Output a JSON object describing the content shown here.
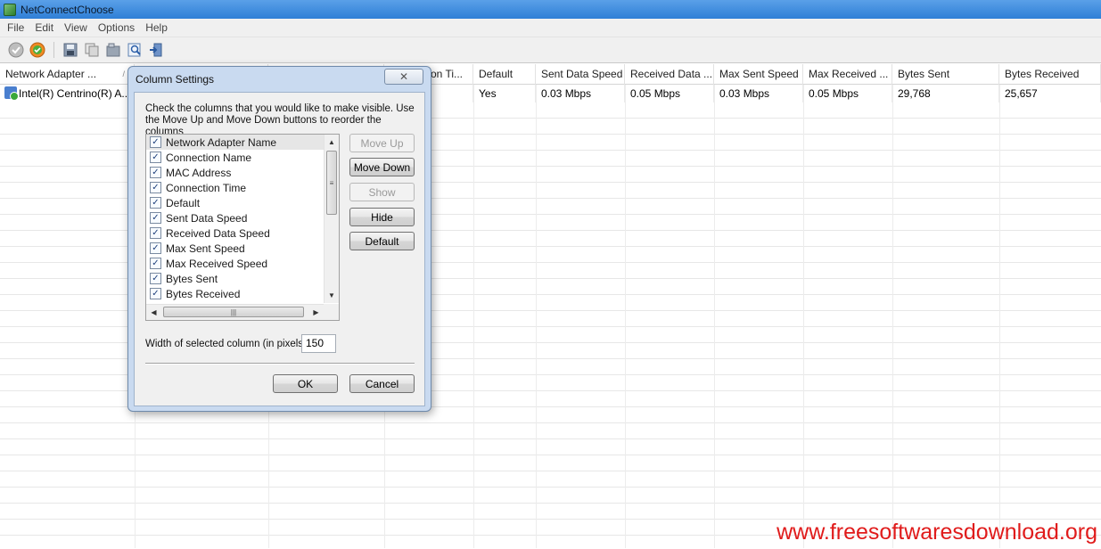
{
  "window": {
    "title": "NetConnectChoose"
  },
  "menu": [
    "File",
    "Edit",
    "View",
    "Options",
    "Help"
  ],
  "toolbar": {
    "icons": [
      "disconnect-icon",
      "connect-icon",
      "save-icon",
      "copy-icon",
      "properties-icon",
      "find-icon",
      "exit-icon"
    ]
  },
  "grid": {
    "columns": [
      "Network Adapter ...",
      "",
      "",
      "on Ti...",
      "Default",
      "Sent Data Speed",
      "Received Data ...",
      "Max Sent Speed",
      "Max Received ...",
      "Bytes Sent",
      "Bytes Received"
    ],
    "row": [
      "Intel(R) Centrino(R) A...",
      "",
      "",
      "",
      "Yes",
      "0.03 Mbps",
      "0.05 Mbps",
      "0.03 Mbps",
      "0.05 Mbps",
      "29,768",
      "25,657"
    ]
  },
  "dialog": {
    "title": "Column Settings",
    "instructions": "Check the columns that you would like to make visible. Use the Move Up and Move Down buttons to reorder the columns",
    "columns": [
      {
        "label": "Network Adapter Name",
        "checked": true
      },
      {
        "label": "Connection Name",
        "checked": true
      },
      {
        "label": "MAC Address",
        "checked": true
      },
      {
        "label": "Connection Time",
        "checked": true
      },
      {
        "label": "Default",
        "checked": true
      },
      {
        "label": "Sent Data Speed",
        "checked": true
      },
      {
        "label": "Received Data Speed",
        "checked": true
      },
      {
        "label": "Max Sent Speed",
        "checked": true
      },
      {
        "label": "Max Received Speed",
        "checked": true
      },
      {
        "label": "Bytes Sent",
        "checked": true
      },
      {
        "label": "Bytes Received",
        "checked": true
      }
    ],
    "buttons": {
      "move_up": "Move Up",
      "move_down": "Move Down",
      "show": "Show",
      "hide": "Hide",
      "default": "Default",
      "ok": "OK",
      "cancel": "Cancel"
    },
    "width_label": "Width of selected column (in pixels):",
    "width_value": "150"
  },
  "watermark": "www.freesoftwaresdownload.org"
}
